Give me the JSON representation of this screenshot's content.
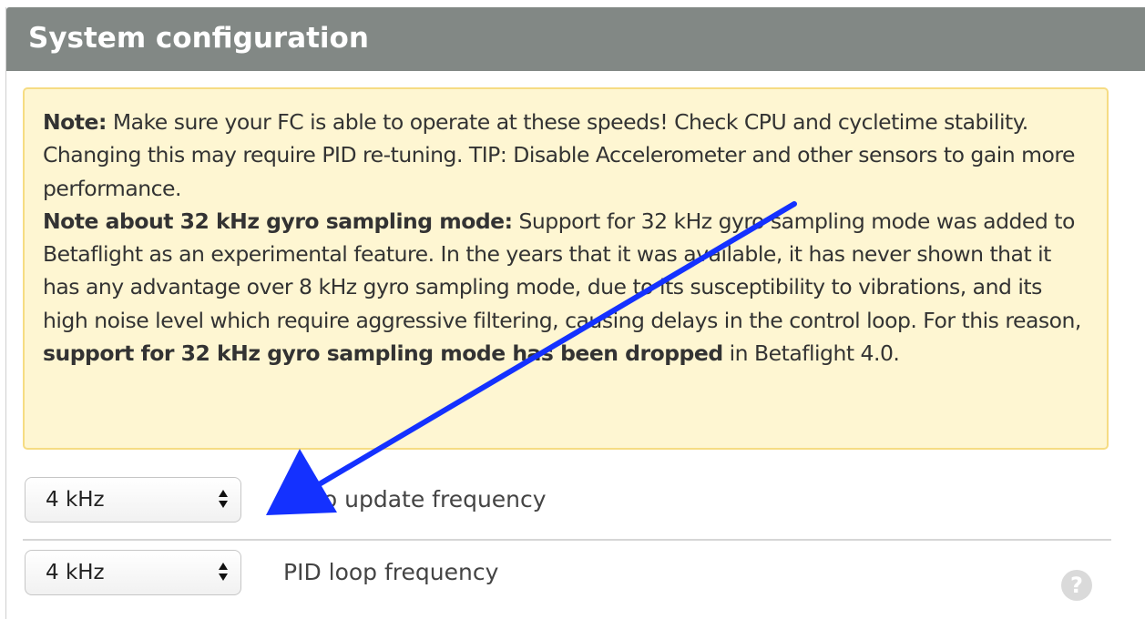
{
  "panel": {
    "title": "System configuration"
  },
  "note": {
    "label1": "Note:",
    "text1": " Make sure your FC is able to operate at these speeds! Check CPU and cycletime stability. Changing this may require PID re-tuning. TIP: Disable Accelerometer and other sensors to gain more performance.",
    "label2": "Note about 32 kHz gyro sampling mode:",
    "text2": " Support for 32 kHz gyro sampling mode was added to Betaflight as an experimental feature. In the years that it was available, it has never shown that it has any advantage over 8 kHz gyro sampling mode, due to its susceptibility to vibrations, and its high noise level which require aggressive filtering, causing delays in the control loop. For this reason, ",
    "strong3": "support for 32 kHz gyro sampling mode has been dropped",
    "text3": " in Betaflight 4.0."
  },
  "settings": [
    {
      "value": "4 kHz",
      "label": "Gyro update frequency"
    },
    {
      "value": "4 kHz",
      "label": "PID loop frequency"
    }
  ],
  "icons": {
    "select_arrows": "up-down-chevron-icon",
    "help": "question-mark-icon",
    "help_glyph": "?",
    "annotation": "blue-arrow-icon"
  },
  "colors": {
    "header_bg": "#828885",
    "note_bg": "#fef6d2",
    "note_border": "#f6dc83",
    "arrow": "#1431ff"
  }
}
